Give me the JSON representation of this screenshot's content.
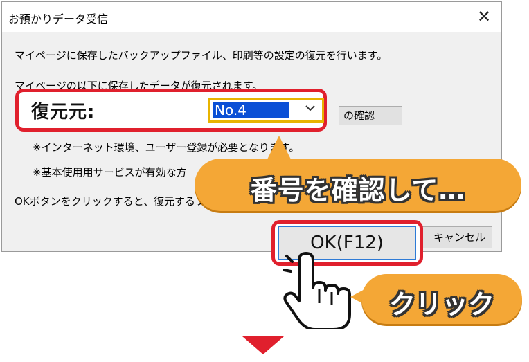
{
  "dialog": {
    "title": "お預かりデータ受信",
    "close_symbol": "✕",
    "line1": "マイページに保存したバックアップファイル、印刷等の設定の復元を行います。",
    "line2": "マイページの以下に保存したデータが復元されます。",
    "note1": "※インターネット環境、ユーザー登録が必要となります。",
    "note2": "※基本使用用サービスが有効な方",
    "line3": "OKボタンをクリックすると、復元するフ",
    "confirm_label": "の確認",
    "cancel_label": "キャンセル"
  },
  "restore": {
    "label": "復元元:",
    "selected": "No.4"
  },
  "ok_button": {
    "label": "OK(F12)"
  },
  "callouts": {
    "confirm": "番号を確認して…",
    "click": "クリック"
  },
  "colors": {
    "highlight": "#e0202d",
    "callout": "#f4a736",
    "selection": "#0a4fd6"
  }
}
